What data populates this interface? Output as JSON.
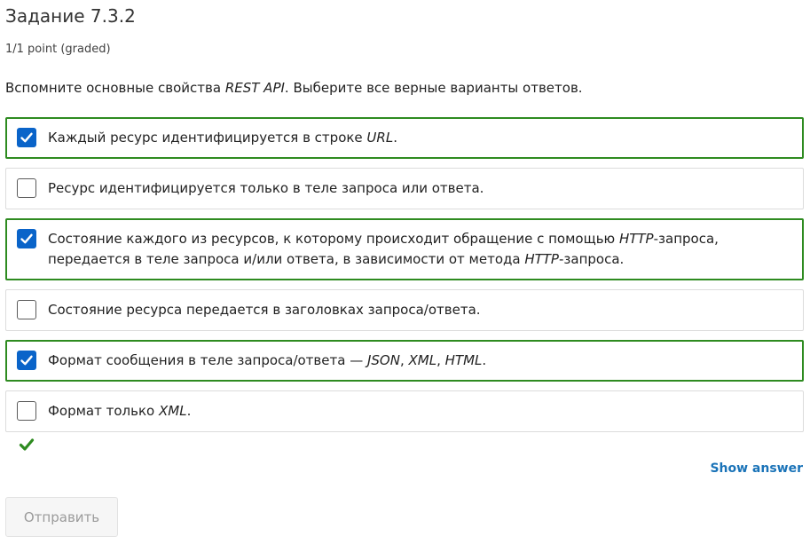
{
  "problem": {
    "title": "Задание 7.3.2",
    "points": "1/1 point (graded)",
    "question": {
      "prefix": "Вспомните основные свойства ",
      "term": "REST API",
      "suffix": ". Выберите все верные варианты ответов."
    }
  },
  "options": [
    {
      "checked": true,
      "parts": {
        "a": "Каждый ресурс идентифицируется в строке ",
        "b": "URL",
        "c": "."
      }
    },
    {
      "checked": false,
      "parts": {
        "a": "Ресурс идентифицируется только в теле запроса или ответа."
      }
    },
    {
      "checked": true,
      "parts": {
        "a": "Состояние каждого из ресурсов, к которому происходит обращение с помощью ",
        "b": "HTTP",
        "c": "-запроса, передается в теле запроса и/или ответа, в зависимости от метода ",
        "d": "HTTP",
        "e": "-запроса."
      }
    },
    {
      "checked": false,
      "parts": {
        "a": "Состояние ресурса передается в заголовках запроса/ответа."
      }
    },
    {
      "checked": true,
      "parts": {
        "a": "Формат сообщения в теле запроса/ответа — ",
        "b": "JSON",
        "c": ", ",
        "d": "XML",
        "e": ", ",
        "f": "HTML",
        "g": "."
      }
    },
    {
      "checked": false,
      "parts": {
        "a": "Формат только ",
        "b": "XML",
        "c": "."
      }
    }
  ],
  "feedback": {
    "icon": "checkmark-icon",
    "status": "correct",
    "color": "#2e8b20"
  },
  "actions": {
    "show_answer": "Show answer",
    "submit": "Отправить"
  },
  "colors": {
    "correct_border": "#2e8b20",
    "checkbox_checked": "#0a64c9",
    "link": "#1a73b8"
  }
}
